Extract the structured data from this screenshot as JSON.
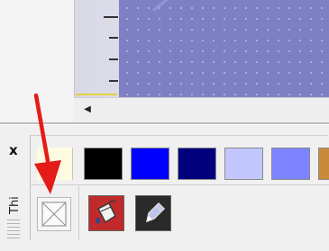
{
  "panel": {
    "title": "Thi",
    "close_glyph": "x"
  },
  "scrollbar": {
    "left_arrow_glyph": "◀"
  },
  "swatches": [
    {
      "name": "black",
      "color": "#000000"
    },
    {
      "name": "blue",
      "color": "#0000ff"
    },
    {
      "name": "navy",
      "color": "#00007d"
    },
    {
      "name": "lavender",
      "color": "#c3c7ff"
    },
    {
      "name": "periwinkle",
      "color": "#7c84ff"
    },
    {
      "name": "tan",
      "color": "#c98a3c"
    }
  ],
  "tools": [
    {
      "name": "no-fill",
      "icon": "crossed-box-icon"
    },
    {
      "name": "fill-bucket",
      "icon": "paint-bucket-icon",
      "bg": "#c02a2a"
    },
    {
      "name": "pen",
      "icon": "pen-icon",
      "bg": "#2a2a2a"
    }
  ],
  "colors": {
    "canvas": "#7d81c4",
    "arrow": "#e41b17",
    "ruler_line": "#e8d23a"
  }
}
